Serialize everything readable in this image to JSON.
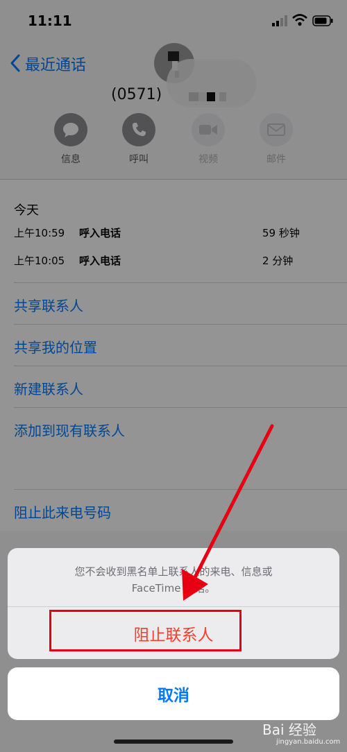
{
  "status_bar": {
    "time": "11:11"
  },
  "nav": {
    "back_label": "最近通话"
  },
  "contact": {
    "number_prefix": "(0571)"
  },
  "actions": [
    {
      "label": "信息",
      "icon": "message-icon",
      "enabled": true
    },
    {
      "label": "呼叫",
      "icon": "phone-icon",
      "enabled": true
    },
    {
      "label": "视频",
      "icon": "video-icon",
      "enabled": false
    },
    {
      "label": "邮件",
      "icon": "mail-icon",
      "enabled": false
    }
  ],
  "calls": {
    "day": "今天",
    "rows": [
      {
        "time": "上午10:59",
        "type": "呼入电话",
        "duration": "59 秒钟"
      },
      {
        "time": "上午10:05",
        "type": "呼入电话",
        "duration": "2 分钟"
      }
    ]
  },
  "options": [
    "共享联系人",
    "共享我的位置",
    "新建联系人",
    "添加到现有联系人"
  ],
  "block_option": "阻止此来电号码",
  "action_sheet": {
    "message_line1": "您不会收到黑名单上联系人的来电、信息或",
    "message_line2": "FaceTime 通话。",
    "destructive_label": "阻止联系人",
    "cancel_label": "取消"
  },
  "watermark": {
    "brand": "Bai 经验",
    "url": "jingyan.baidu.com"
  },
  "colors": {
    "accent": "#007aff",
    "destructive": "#ff3b30",
    "annotation": "#e60012"
  }
}
